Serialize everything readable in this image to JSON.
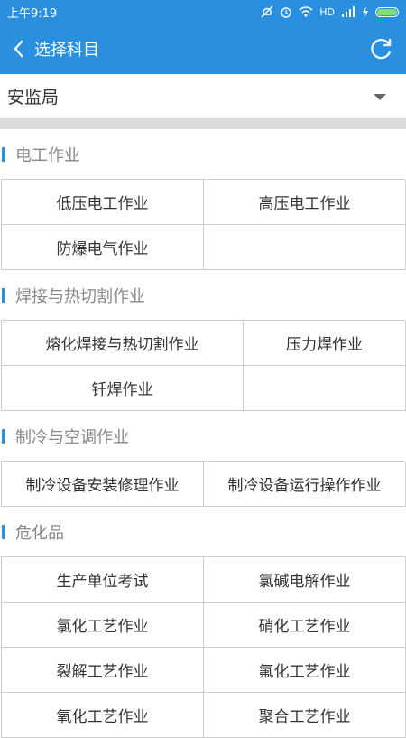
{
  "status_bar": {
    "time": "上午9:19",
    "network": "HD"
  },
  "header": {
    "title": "选择科目"
  },
  "selector": {
    "value": "安监局"
  },
  "sections": [
    {
      "title": "电工作业",
      "items": [
        "低压电工作业",
        "高压电工作业",
        "防爆电气作业",
        ""
      ]
    },
    {
      "title": "焊接与热切割作业",
      "items": [
        "熔化焊接与热切割作业",
        "压力焊作业",
        "钎焊作业",
        ""
      ]
    },
    {
      "title": "制冷与空调作业",
      "items": [
        "制冷设备安装修理作业",
        "制冷设备运行操作作业"
      ]
    },
    {
      "title": "危化品",
      "items": [
        "生产单位考试",
        "氯碱电解作业",
        "氯化工艺作业",
        "硝化工艺作业",
        "裂解工艺作业",
        "氟化工艺作业",
        "氧化工艺作业",
        "聚合工艺作业"
      ]
    }
  ]
}
